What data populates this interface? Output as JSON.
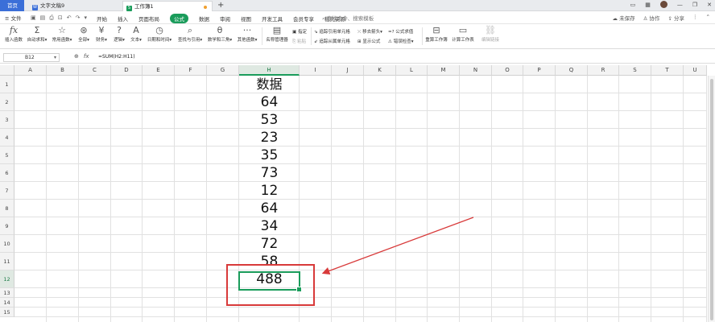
{
  "tabs": {
    "home": "首页",
    "doc": "文字文稿9",
    "sheet": "工作簿1",
    "doc_badge": "W",
    "sheet_badge": "S"
  },
  "window": {
    "unsaved": "未保存",
    "collab": "协作",
    "share": "分享"
  },
  "menubar": {
    "file": "文件",
    "items": [
      "开始",
      "插入",
      "页面布局",
      "公式",
      "数据",
      "审阅",
      "视图",
      "开发工具",
      "会员专享",
      "稻壳资源"
    ],
    "active_index": 3,
    "search": "查找命令、搜索模板"
  },
  "ribbon": {
    "insert_function": "插入函数",
    "autosum": "自动求和",
    "common": "常用函数",
    "all": "全部",
    "finance": "财务",
    "logic": "逻辑",
    "text": "文本",
    "datetime": "日期和时间",
    "lookup": "查找与引用",
    "math": "数学和三角",
    "other": "其他函数",
    "name_manager": "名称管理器",
    "specify": "指定",
    "paste": "粘贴",
    "trace_precedents": "追踪引用单元格",
    "trace_dependents": "追踪从属单元格",
    "remove_arrows": "移去箭头",
    "show_formula": "显示公式",
    "evaluate": "公式求值",
    "error_check": "错误检查",
    "recalc": "重算工作簿",
    "calc_sheet": "计算工作表",
    "edit_links": "编辑链接"
  },
  "formula_bar": {
    "name_box": "B12",
    "formula": "=SUM(H2:H11)"
  },
  "columns": [
    "A",
    "B",
    "C",
    "D",
    "E",
    "F",
    "G",
    "H",
    "I",
    "J",
    "K",
    "L",
    "M",
    "N",
    "O",
    "P",
    "Q",
    "R",
    "S",
    "T",
    "U"
  ],
  "selected_column": "H",
  "rows": [
    "1",
    "2",
    "3",
    "4",
    "5",
    "6",
    "7",
    "8",
    "9",
    "10",
    "11",
    "12",
    "13",
    "14",
    "15"
  ],
  "selected_row": "12",
  "column_h": {
    "header": "数据",
    "values": [
      "64",
      "53",
      "23",
      "35",
      "73",
      "12",
      "64",
      "34",
      "72",
      "58"
    ],
    "total": "488"
  },
  "colors": {
    "accent": "#1a9c5b",
    "annotation": "#d83a3a",
    "home_tab": "#3b6fd8"
  }
}
